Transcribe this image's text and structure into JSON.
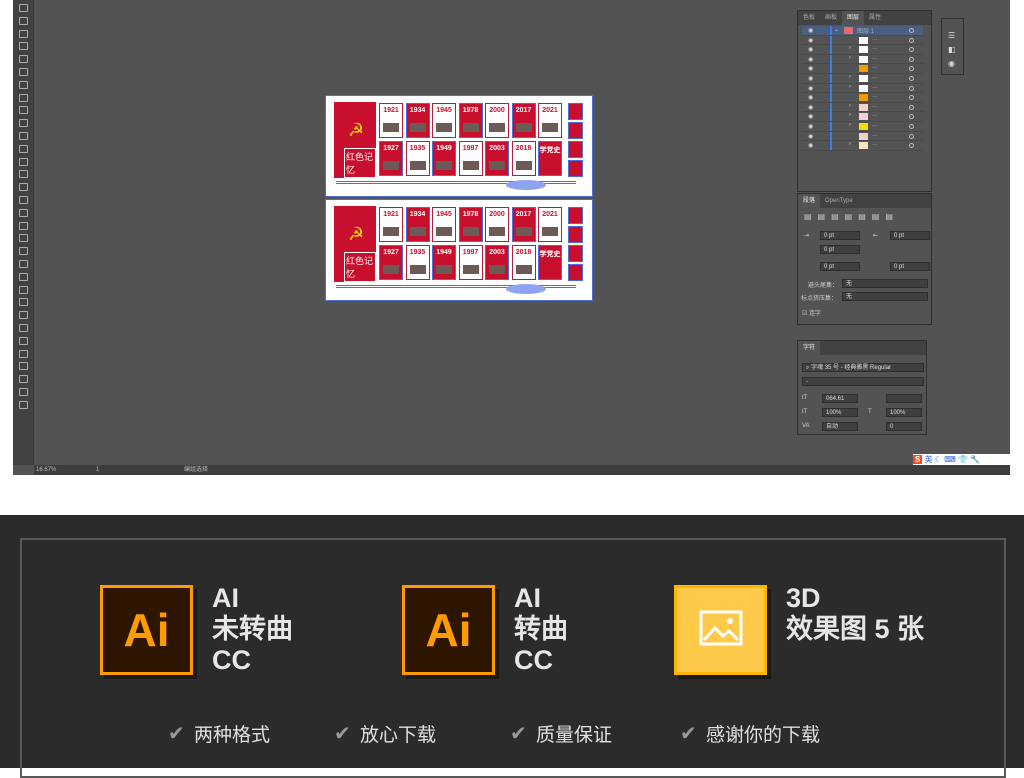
{
  "status_bar": {
    "zoom": "16.67%",
    "page": "1",
    "tool_status": "编组选择"
  },
  "artboards": [
    {
      "flag_text": "红色记忆",
      "top_years": [
        "1921",
        "1934",
        "1945",
        "1978",
        "2000",
        "2017",
        "2021"
      ],
      "bottom_years": [
        "1927",
        "1935",
        "1949",
        "1997",
        "2003",
        "2018"
      ],
      "bottom_panel": "学党史"
    },
    {
      "flag_text": "红色记忆",
      "top_years": [
        "1921",
        "1934",
        "1945",
        "1978",
        "2000",
        "2017",
        "2021"
      ],
      "bottom_years": [
        "1927",
        "1935",
        "1949",
        "1997",
        "2003",
        "2018"
      ],
      "bottom_panel": "学党史"
    }
  ],
  "layers_panel": {
    "tabs": [
      "色板",
      "画板",
      "图层",
      "属性"
    ],
    "active_tab": "图层",
    "top_layer": "图层 1",
    "row_dots": "..."
  },
  "paragraph_panel": {
    "tabs": [
      "段落",
      "OpenType"
    ],
    "indent_left": "0 pt",
    "indent_right": "0 pt",
    "first_line": "0 pt",
    "space_before": "0 pt",
    "space_after": "0 pt",
    "kinsoku_label": "避头尾集：",
    "kinsoku_value": "无",
    "mojikumi_label": "标点挤压集：",
    "mojikumi_value": "无",
    "hyphenate_label": "连字",
    "hyphenate_checked": true
  },
  "character_panel": {
    "tab": "字符",
    "font": "字魂 35 号 - 经典雅黑 Regular",
    "style": "-",
    "size": "064.61",
    "vscale": "100%",
    "hscale": "100%",
    "tracking": "自动",
    "kerning": "0"
  },
  "ime_bar": {
    "label": "英"
  },
  "banner": {
    "items": [
      {
        "icon": "Ai",
        "lines": [
          "AI",
          "未转曲",
          "CC"
        ]
      },
      {
        "icon": "Ai",
        "lines": [
          "AI",
          "转曲",
          "CC"
        ]
      },
      {
        "icon": "image-icon",
        "lines": [
          "3D",
          "效果图 5 张"
        ]
      }
    ],
    "checks": [
      "两种格式",
      "放心下载",
      "质量保证",
      "感谢你的下载"
    ],
    "colors": {
      "ai_orange": "#ff9a00",
      "ai_bg": "#2e1500",
      "image_yellow": "#ffc94a"
    }
  }
}
